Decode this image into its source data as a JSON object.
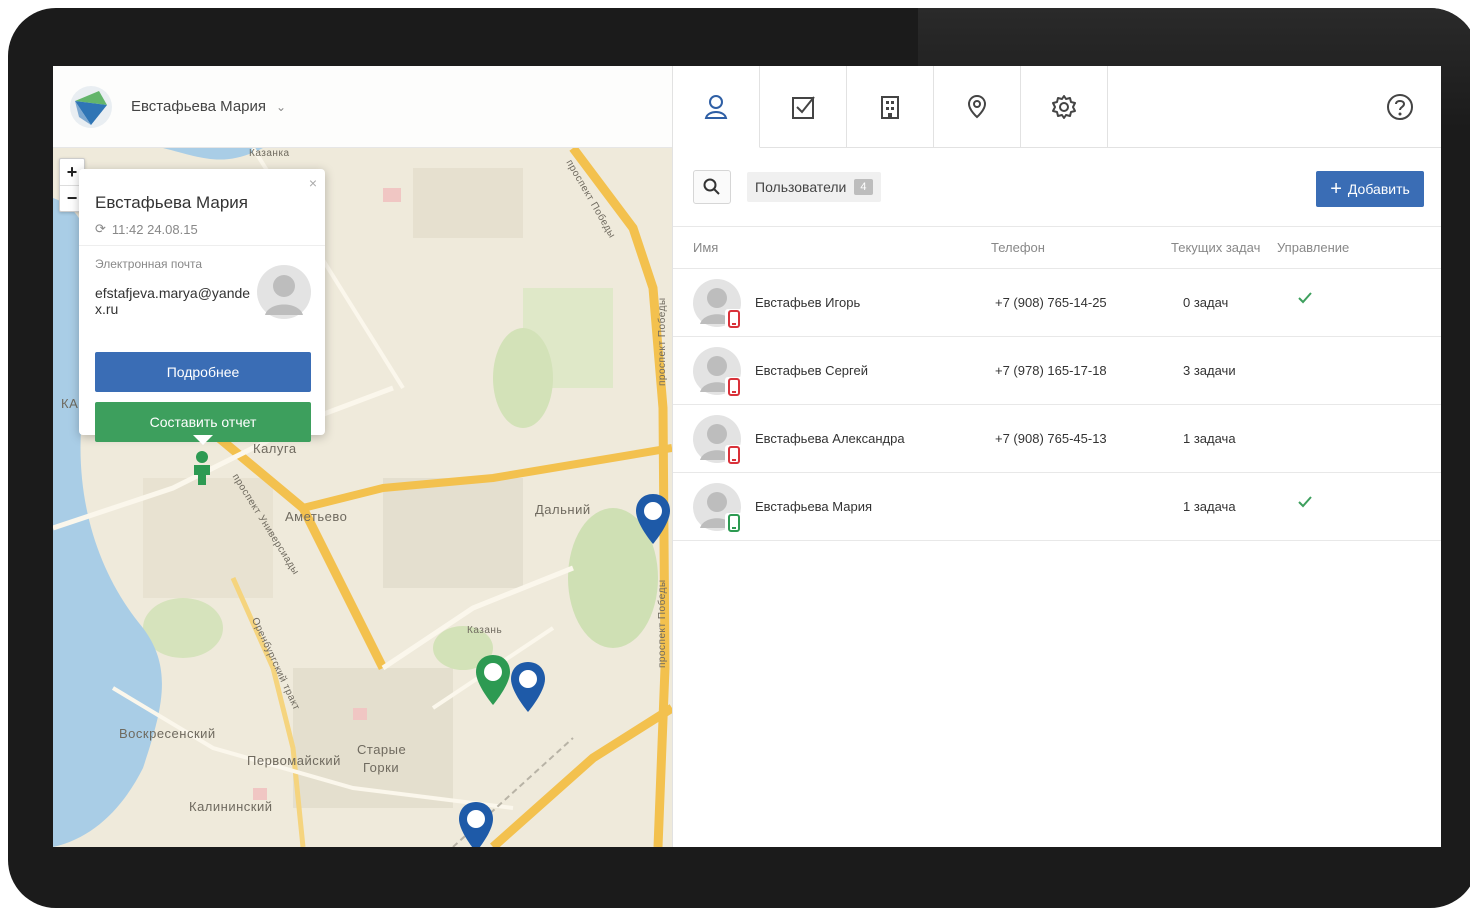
{
  "app": {
    "current_user": "Евстафьева Мария"
  },
  "map": {
    "zoom_in": "+",
    "zoom_out": "−",
    "labels": {
      "kazanka": "Казанка",
      "kaluga": "Калуга",
      "ametyevo": "Аметьево",
      "dalniy": "Дальний",
      "kazan": "Казань",
      "voskresenskiy": "Воскресенский",
      "pervomayskiy": "Первомайский",
      "starye_gorki_1": "Старые",
      "starye_gorki_2": "Горки",
      "kalininskiy": "Калининский",
      "prospekt_pobedy_1": "проспект Победы",
      "prospekt_pobedy_2": "проспект Победы",
      "prospekt_pobedy_3": "проспект Победы",
      "prospekt_universiady": "проспект Универсиады",
      "orenburgskiy_trakt": "Оренбургский тракт",
      "edge_ka": "КА"
    },
    "popup": {
      "name": "Евстафьева Мария",
      "time": "11:42 24.08.15",
      "email_label": "Электронная почта",
      "email": "efstafjeva.marya@yandex.ru",
      "details_button": "Подробнее",
      "report_button": "Составить отчет",
      "close": "×"
    },
    "colors": {
      "pin_blue": "#1e5aa8",
      "pin_green": "#2d9a52"
    }
  },
  "tabs": [
    {
      "icon": "user-icon",
      "active": true
    },
    {
      "icon": "checkbox-icon"
    },
    {
      "icon": "building-icon"
    },
    {
      "icon": "map-pin-icon"
    },
    {
      "icon": "gear-icon"
    }
  ],
  "toolbar": {
    "filter_label": "Пользователи",
    "filter_count": "4",
    "add_label": "Добавить"
  },
  "table": {
    "headers": {
      "name": "Имя",
      "phone": "Телефон",
      "tasks": "Текущих задач",
      "manage": "Управление"
    },
    "rows": [
      {
        "name": "Евстафьев Игорь",
        "phone": "+7 (908) 765-14-25",
        "tasks": "0 задач",
        "manage": true,
        "device": "red"
      },
      {
        "name": "Евстафьев Сергей",
        "phone": "+7 (978) 165-17-18",
        "tasks": "3 задачи",
        "manage": false,
        "device": "red"
      },
      {
        "name": "Евстафьева Александра",
        "phone": "+7 (908) 765-45-13",
        "tasks": "1 задача",
        "manage": false,
        "device": "red"
      },
      {
        "name": "Евстафьева Мария",
        "phone": "",
        "tasks": "1 задача",
        "manage": true,
        "device": "green"
      }
    ]
  }
}
